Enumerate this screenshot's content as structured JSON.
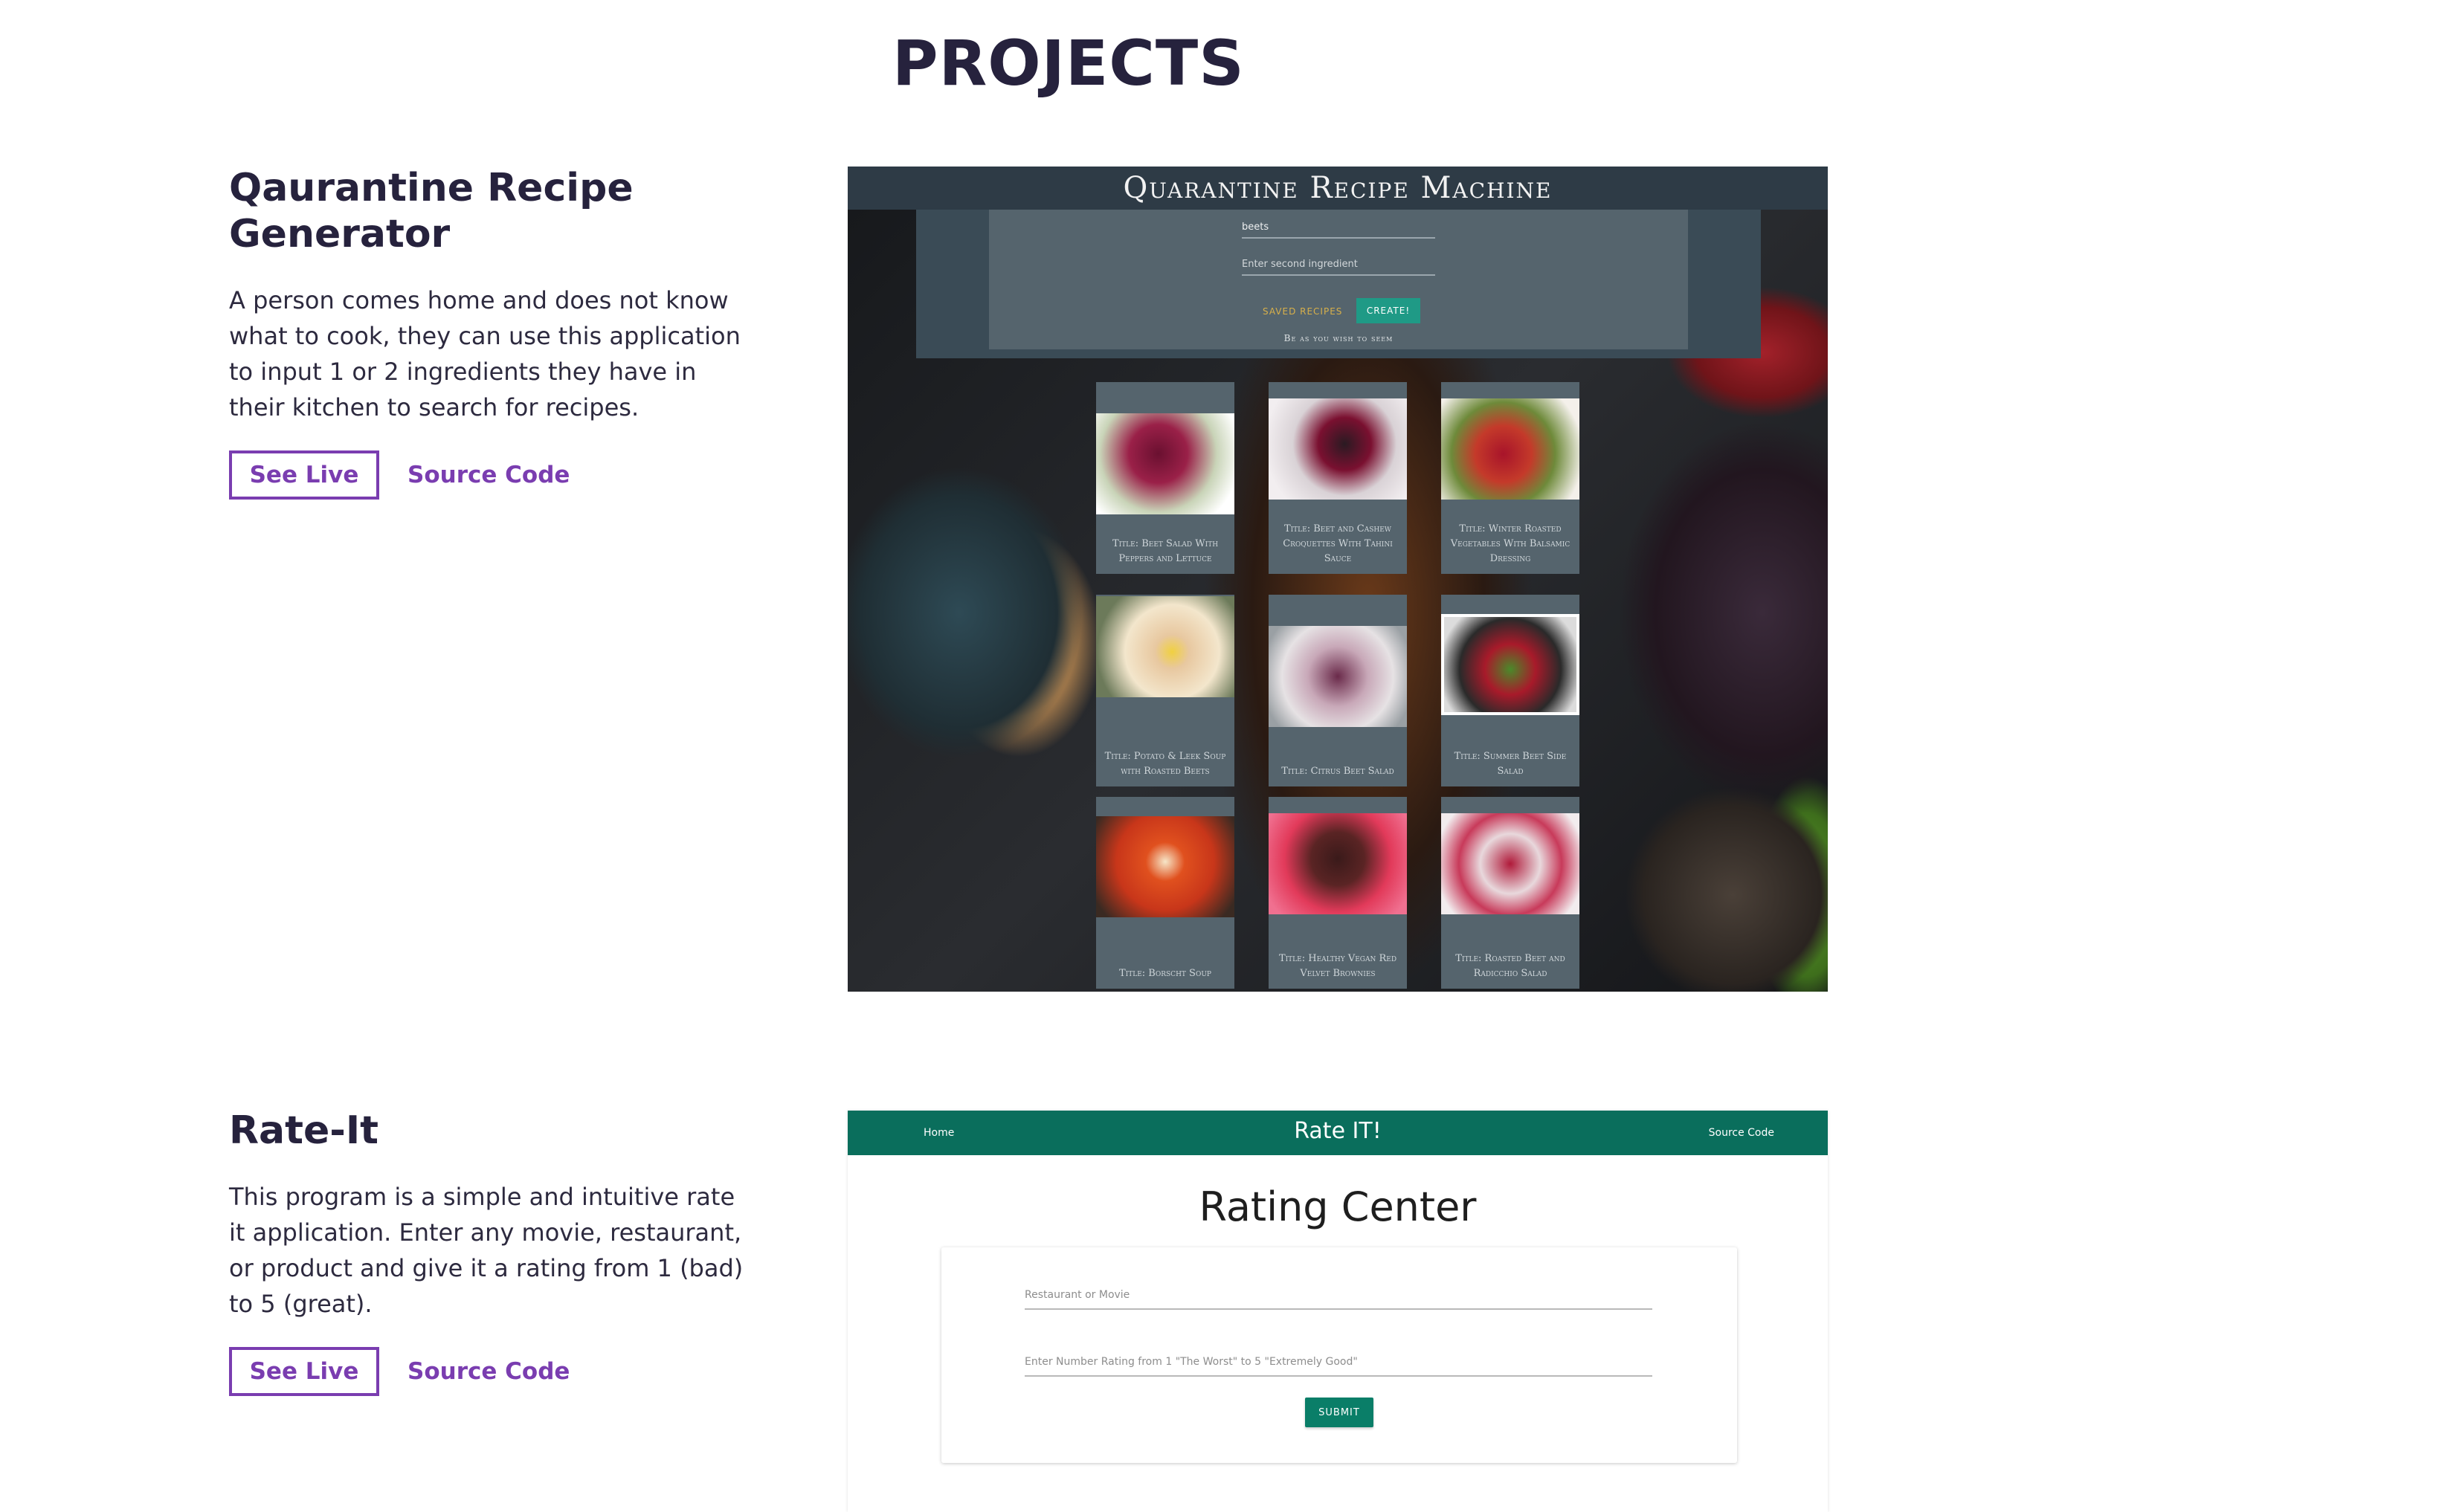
{
  "page": {
    "title": "PROJECTS"
  },
  "projects": [
    {
      "title": "Qaurantine Recipe Generator",
      "description": "A person comes home and does not know what to cook, they can use this application to input 1 or 2 ingredients they have in their kitchen to search for recipes.",
      "see_live_label": "See Live",
      "source_code_label": "Source Code"
    },
    {
      "title": "Rate-It",
      "description": "This program is a simple and intuitive rate it application. Enter any movie, restaurant, or product and give it a rating from 1 (bad) to 5 (great).",
      "see_live_label": "See Live",
      "source_code_label": "Source Code"
    }
  ],
  "recipe_app": {
    "header": "Quarantine Recipe Machine",
    "ingredient_value": "beets",
    "second_ingredient_placeholder": "Enter second ingredient",
    "saved_recipes_label": "SAVED RECIPES",
    "create_label": "CREATE!",
    "motto": "Be as you wish to seem",
    "cards": [
      "Title: Beet Salad With Peppers and Lettuce",
      "Title: Beet and Cashew Croquettes With Tahini Sauce",
      "Title: Winter Roasted Vegetables With Balsamic Dressing",
      "Title: Potato & Leek Soup with Roasted Beets",
      "Title: Citrus Beet Salad",
      "Title: Summer Beet Side Salad",
      "Title: Borscht Soup",
      "Title: Healthy Vegan Red Velvet Brownies",
      "Title: Roasted Beet and Radicchio Salad"
    ]
  },
  "rate_app": {
    "nav_home": "Home",
    "brand": "Rate IT!",
    "nav_source": "Source Code",
    "heading": "Rating Center",
    "name_placeholder": "Restaurant or Movie",
    "rating_placeholder": "Enter Number Rating from 1 \"The Worst\" to 5 \"Extremely Good\"",
    "submit_label": "SUBMIT"
  },
  "colors": {
    "accent": "#7a3db0",
    "heading": "#26223d",
    "recipe_header": "#2e3b46",
    "recipe_panel": "#55646d",
    "recipe_button": "#1f9a86",
    "rate_nav": "#0a6e5c"
  }
}
